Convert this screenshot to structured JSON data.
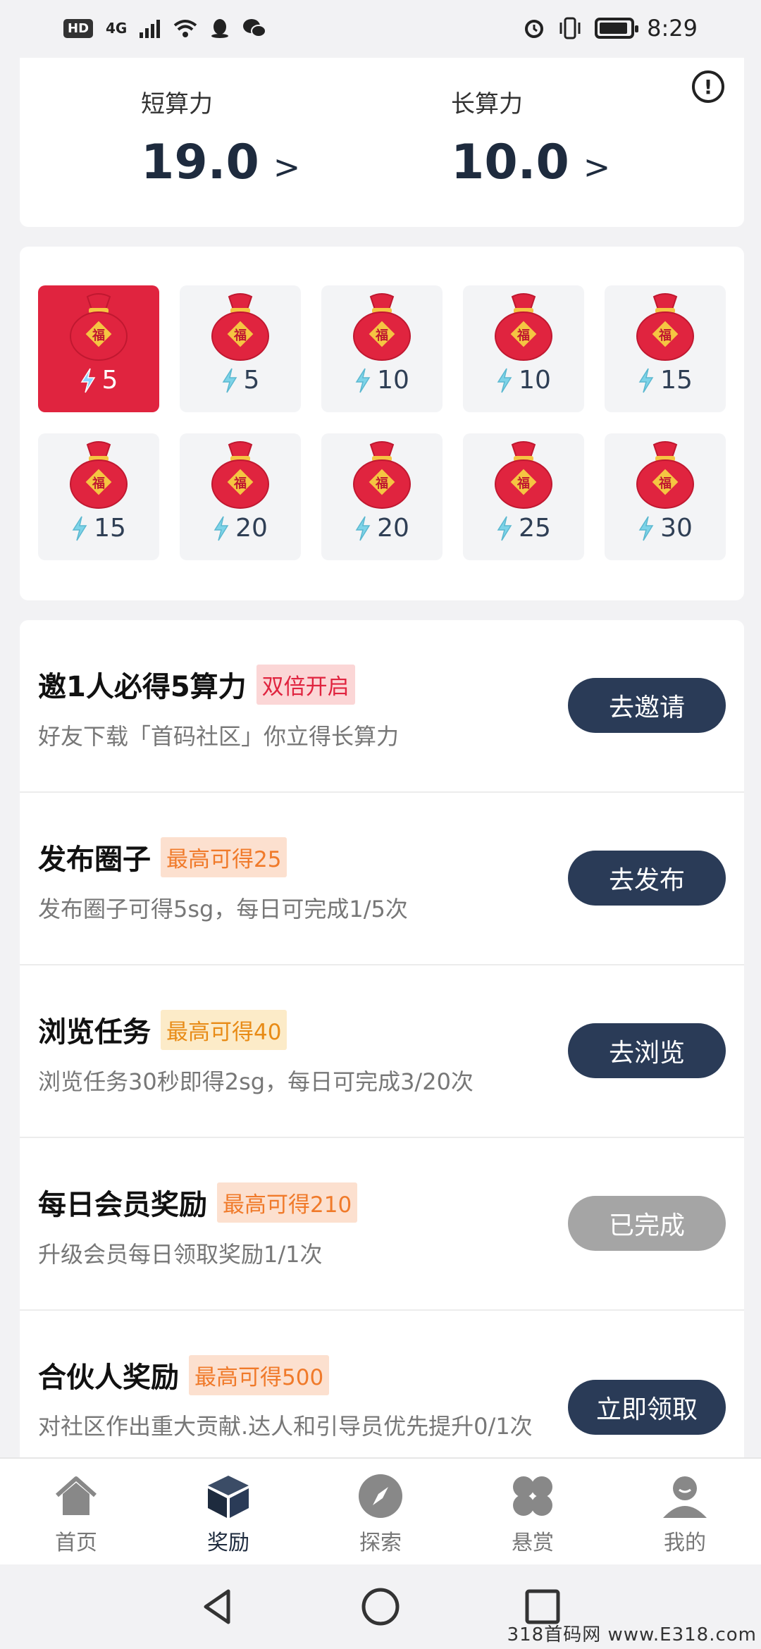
{
  "status_bar": {
    "hd": "HD",
    "network": "4G",
    "time": "8:29",
    "icons": [
      "signal-icon",
      "wifi-icon",
      "qq-icon",
      "wechat-icon",
      "alarm-icon",
      "vibrate-icon",
      "battery-icon"
    ]
  },
  "compute": {
    "short_label": "短算力",
    "short_value": "19.0",
    "long_label": "长算力",
    "long_value": "10.0",
    "arrow": ">"
  },
  "packets": [
    {
      "amount": "5",
      "selected": true
    },
    {
      "amount": "5",
      "selected": false
    },
    {
      "amount": "10",
      "selected": false
    },
    {
      "amount": "10",
      "selected": false
    },
    {
      "amount": "15",
      "selected": false
    },
    {
      "amount": "15",
      "selected": false
    },
    {
      "amount": "20",
      "selected": false
    },
    {
      "amount": "20",
      "selected": false
    },
    {
      "amount": "25",
      "selected": false
    },
    {
      "amount": "30",
      "selected": false
    }
  ],
  "packet_glyph": "福",
  "tasks": [
    {
      "title": "邀1人必得5算力",
      "tag": "双倍开启",
      "desc": "好友下载「首码社区」你立得长算力",
      "button": "去邀请"
    },
    {
      "title": "发布圈子",
      "tag": "最高可得25",
      "desc": "发布圈子可得5sg，每日可完成1/5次",
      "button": "去发布"
    },
    {
      "title": "浏览任务",
      "tag": "最高可得40",
      "desc": "浏览任务30秒即得2sg，每日可完成3/20次",
      "button": "去浏览"
    },
    {
      "title": "每日会员奖励",
      "tag": "最高可得210",
      "desc": "升级会员每日领取奖励1/1次",
      "button": "已完成"
    },
    {
      "title": "合伙人奖励",
      "tag": "最高可得500",
      "desc": "对社区作出重大贡献.达人和引导员优先提升0/1次",
      "button": "立即领取"
    }
  ],
  "tabs": [
    {
      "label": "首页",
      "icon": "home-icon"
    },
    {
      "label": "奖励",
      "icon": "reward-box-icon"
    },
    {
      "label": "探索",
      "icon": "compass-icon"
    },
    {
      "label": "悬赏",
      "icon": "clover-icon"
    },
    {
      "label": "我的",
      "icon": "user-icon"
    }
  ],
  "colors": {
    "accent_dark": "#2a3b57",
    "packet_selected": "#e0243f",
    "done_button": "#a5a5a5"
  },
  "watermark": "318首码网 www.E318.com"
}
